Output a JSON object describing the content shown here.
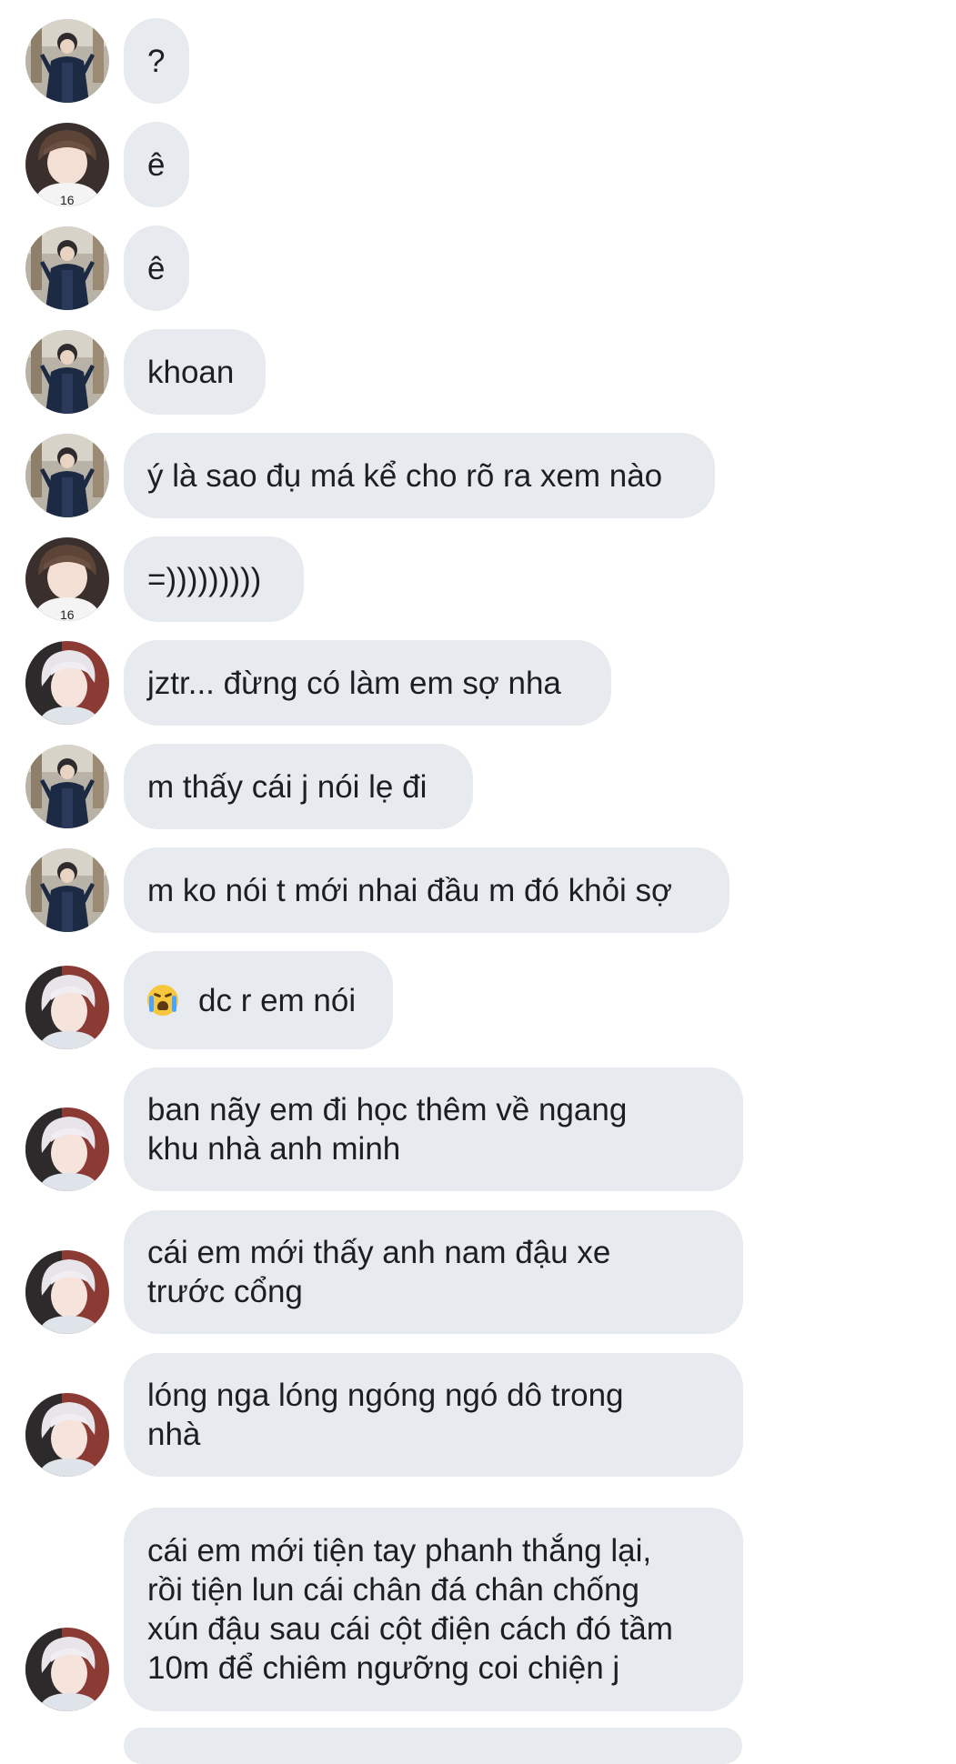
{
  "messages": [
    {
      "avatar": "boy-dark-jacket-avatar",
      "text": "?"
    },
    {
      "avatar": "boy-white-shirt-avatar",
      "text": "ê"
    },
    {
      "avatar": "boy-dark-jacket-avatar",
      "text": "ê"
    },
    {
      "avatar": "boy-dark-jacket-avatar",
      "text": "khoan"
    },
    {
      "avatar": "boy-dark-jacket-avatar",
      "text": "ý là sao đụ má kể cho rõ ra xem nào"
    },
    {
      "avatar": "boy-white-shirt-avatar",
      "text": "=)))))))))"
    },
    {
      "avatar": "silver-hair-avatar",
      "text": "jztr... đừng có làm em sợ nha"
    },
    {
      "avatar": "boy-dark-jacket-avatar",
      "text": "m thấy cái j nói lẹ đi"
    },
    {
      "avatar": "boy-dark-jacket-avatar",
      "text": "m ko nói t mới nhai đầu m đó khỏi sợ"
    },
    {
      "avatar": "silver-hair-avatar",
      "emoji": "loudly-crying-face-emoji",
      "text": "dc r em nói"
    },
    {
      "avatar": "silver-hair-avatar",
      "text": "ban nãy em đi học thêm về ngang\nkhu nhà anh minh"
    },
    {
      "avatar": "silver-hair-avatar",
      "text": "cái em mới thấy anh nam đậu xe\ntrước cổng"
    },
    {
      "avatar": "silver-hair-avatar",
      "text": "lóng nga lóng ngóng ngó dô trong\nnhà"
    },
    {
      "avatar": "silver-hair-avatar",
      "text": "cái em mới tiện tay phanh thắng lại,\nrồi tiện lun cái chân đá chân chống\nxún đậu sau cái cột điện cách đó tầm\n10m để chiêm ngưỡng coi chiện j"
    }
  ],
  "colors": {
    "bubble": "#e7eaef",
    "text": "#1c1e21",
    "background": "#ffffff"
  }
}
